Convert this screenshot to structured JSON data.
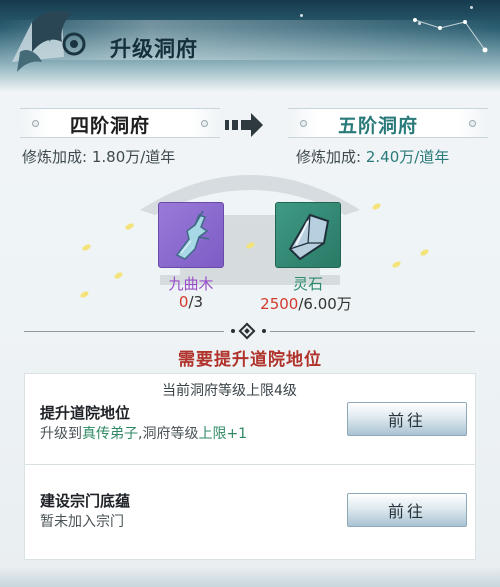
{
  "header": {
    "title": "升级洞府"
  },
  "current_level": {
    "name": "四阶洞府",
    "stat_label": "修炼加成:",
    "stat_value": "1.80万/道年"
  },
  "next_level": {
    "name": "五阶洞府",
    "stat_label": "修炼加成:",
    "stat_value": "2.40万/道年"
  },
  "materials": [
    {
      "name": "九曲木",
      "have": "0",
      "need": "/3",
      "icon": "wood-branch-icon"
    },
    {
      "name": "灵石",
      "have": "2500",
      "need": "/6.00万",
      "icon": "spirit-stone-icon"
    }
  ],
  "requirements_title": "需要提升道院地位",
  "requirements": [
    {
      "note": "当前洞府等级上限4级",
      "name": "提升道院地位",
      "desc_prefix": "升级到",
      "desc_hl1": "真传弟子",
      "desc_mid": ",洞府等级",
      "desc_hl2": "上限+1",
      "button": "前往"
    },
    {
      "name": "建设宗门底蕴",
      "desc": "暂未加入宗门",
      "button": "前往"
    }
  ],
  "colors": {
    "accent_teal": "#2b7a7a",
    "warning_red": "#d23a2e",
    "title_red": "#b0322a",
    "highlight_green": "#2f8a63",
    "rare_purple": "#9a4fc8"
  }
}
